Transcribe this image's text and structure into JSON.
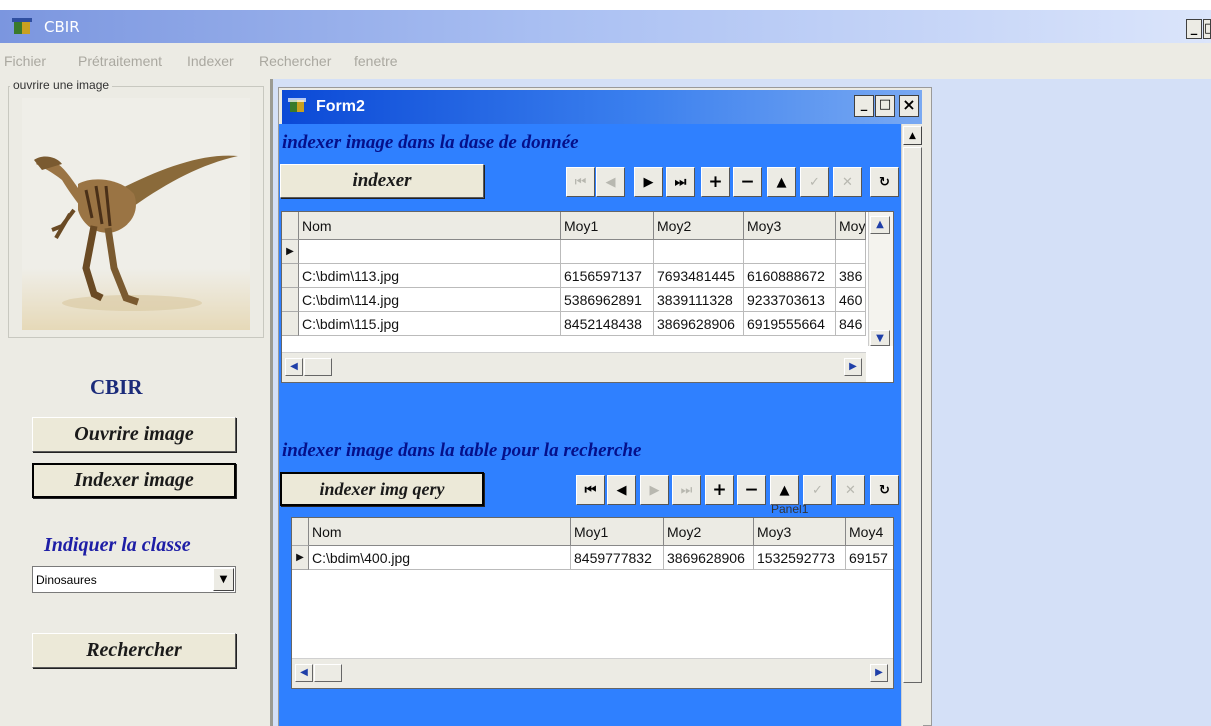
{
  "app": {
    "title": "CBIR",
    "minimize_glyph": "_",
    "maximize_glyph": "□"
  },
  "menu": [
    "Fichier",
    "Prétraitement",
    "Indexer",
    "Rechercher",
    "fenetre"
  ],
  "left": {
    "image_caption": "ouvrire une image",
    "heading": "CBIR",
    "open_button": "Ouvrire image",
    "index_button": "Indexer image",
    "class_label": "Indiquer la classe",
    "class_value": "Dinosaures",
    "search_button": "Rechercher"
  },
  "form2": {
    "title": "Form2",
    "minimize_glyph": "_",
    "maximize_glyph": "□",
    "close_glyph": "×",
    "section1": {
      "title": "indexer image dans la dase de donnée",
      "button": "indexer",
      "columns": [
        "Nom",
        "Moy1",
        "Moy2",
        "Moy3",
        "Moy"
      ],
      "rows": [
        [
          "",
          "",
          "",
          "",
          ""
        ],
        [
          "C:\\bdim\\113.jpg",
          "6156597137",
          "7693481445",
          "6160888672",
          "386"
        ],
        [
          "C:\\bdim\\114.jpg",
          "5386962891",
          "3839111328",
          "9233703613",
          "460"
        ],
        [
          "C:\\bdim\\115.jpg",
          "8452148438",
          "3869628906",
          "6919555664",
          "846"
        ]
      ]
    },
    "section2": {
      "title": "indexer image dans la table pour la recherche",
      "button": "indexer img qery",
      "hidden_label": "Panel1",
      "columns": [
        "Nom",
        "Moy1",
        "Moy2",
        "Moy3",
        "Moy4"
      ],
      "rows": [
        [
          "C:\\bdim\\400.jpg",
          "8459777832",
          "3869628906",
          "1532592773",
          "69157"
        ]
      ]
    }
  },
  "navigator_icons": [
    "first-icon",
    "prior-icon",
    "next-icon",
    "last-icon",
    "insert-icon",
    "delete-icon",
    "edit-icon",
    "post-icon",
    "cancel-icon",
    "refresh-icon"
  ],
  "colors": {
    "form_client": "#2f80ff",
    "title_active": "#0b49d6",
    "heading_blue": "#1e1ea6"
  }
}
